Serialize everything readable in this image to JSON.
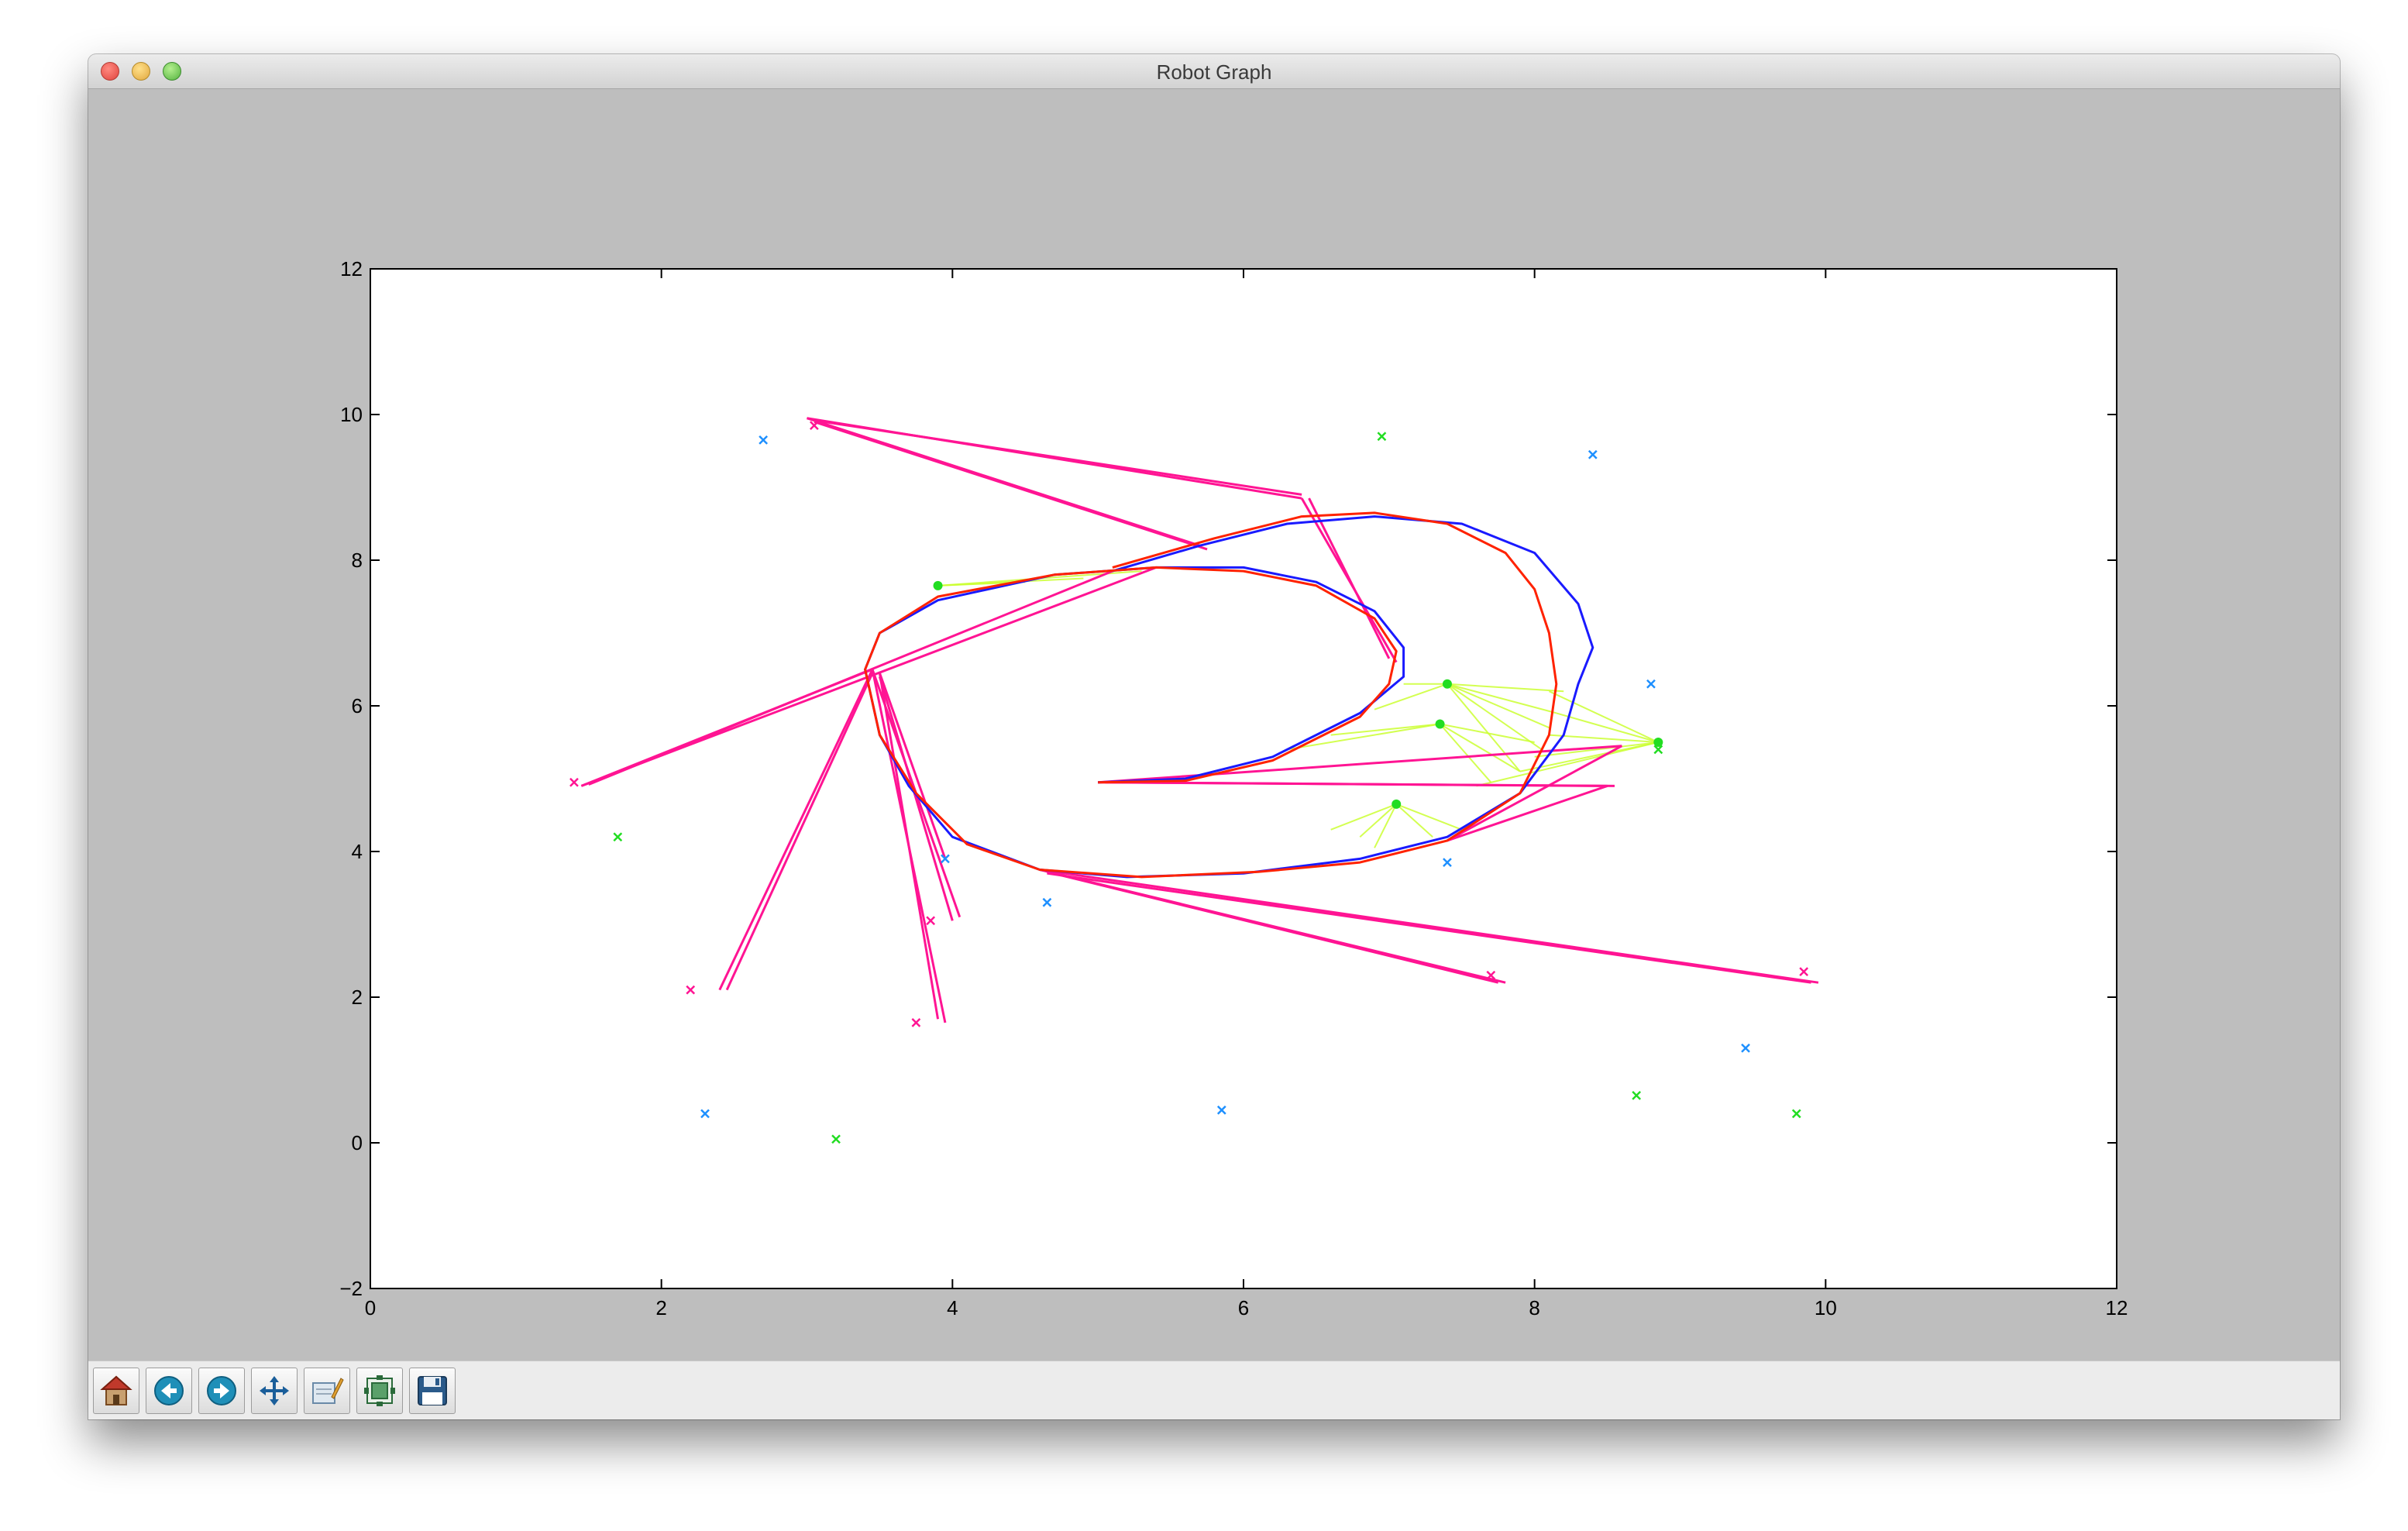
{
  "window": {
    "title": "Robot Graph"
  },
  "toolbar": {
    "buttons": [
      {
        "icon": "home-icon"
      },
      {
        "icon": "back-arrow-icon"
      },
      {
        "icon": "forward-arrow-icon"
      },
      {
        "icon": "pan-icon"
      },
      {
        "icon": "zoom-rectangle-icon"
      },
      {
        "icon": "configure-subplots-icon"
      },
      {
        "icon": "save-icon"
      }
    ]
  },
  "chart_data": {
    "type": "line",
    "title": "",
    "xlabel": "",
    "ylabel": "",
    "xlim": [
      0,
      12
    ],
    "ylim": [
      -2,
      12
    ],
    "xticks": [
      "0",
      "2",
      "4",
      "6",
      "8",
      "10",
      "12"
    ],
    "yticks": [
      "−2",
      "0",
      "2",
      "4",
      "6",
      "8",
      "10",
      "12"
    ],
    "grid": false,
    "colors": {
      "blue": "#1a1aff",
      "red": "#ff2200",
      "magenta": "#ff1493",
      "green": "#22dd22",
      "lime": "#ccff33",
      "cyan": "#1e90ff"
    },
    "series": [
      {
        "color": "blue",
        "points": [
          [
            5.0,
            4.95
          ],
          [
            5.6,
            5.0
          ],
          [
            6.2,
            5.3
          ],
          [
            6.8,
            5.9
          ],
          [
            7.1,
            6.4
          ],
          [
            7.1,
            6.8
          ],
          [
            6.9,
            7.3
          ],
          [
            6.5,
            7.7
          ],
          [
            6.0,
            7.9
          ],
          [
            5.4,
            7.9
          ],
          [
            4.7,
            7.8
          ],
          [
            3.9,
            7.45
          ],
          [
            3.5,
            7.0
          ],
          [
            3.4,
            6.5
          ],
          [
            3.5,
            5.6
          ],
          [
            3.7,
            4.9
          ],
          [
            4.0,
            4.2
          ],
          [
            4.6,
            3.75
          ],
          [
            5.2,
            3.65
          ],
          [
            6.0,
            3.7
          ],
          [
            6.8,
            3.9
          ],
          [
            7.4,
            4.2
          ],
          [
            7.9,
            4.8
          ],
          [
            8.2,
            5.6
          ],
          [
            8.3,
            6.3
          ],
          [
            8.4,
            6.8
          ],
          [
            8.3,
            7.4
          ],
          [
            8.0,
            8.1
          ],
          [
            7.5,
            8.5
          ],
          [
            6.9,
            8.6
          ],
          [
            6.3,
            8.5
          ],
          [
            5.7,
            8.2
          ],
          [
            5.1,
            7.85
          ]
        ]
      },
      {
        "color": "red",
        "points": [
          [
            5.0,
            4.95
          ],
          [
            5.6,
            4.97
          ],
          [
            6.2,
            5.25
          ],
          [
            6.8,
            5.85
          ],
          [
            7.0,
            6.3
          ],
          [
            7.05,
            6.75
          ],
          [
            6.9,
            7.2
          ],
          [
            6.5,
            7.65
          ],
          [
            6.0,
            7.85
          ],
          [
            5.4,
            7.9
          ],
          [
            4.7,
            7.8
          ],
          [
            3.9,
            7.5
          ],
          [
            3.5,
            7.0
          ],
          [
            3.4,
            6.5
          ],
          [
            3.5,
            5.6
          ],
          [
            3.75,
            4.8
          ],
          [
            4.1,
            4.1
          ],
          [
            4.6,
            3.75
          ],
          [
            5.3,
            3.65
          ],
          [
            6.1,
            3.72
          ],
          [
            6.8,
            3.85
          ],
          [
            7.4,
            4.15
          ],
          [
            7.9,
            4.8
          ],
          [
            8.1,
            5.6
          ],
          [
            8.15,
            6.3
          ],
          [
            8.1,
            7.0
          ],
          [
            8.0,
            7.6
          ],
          [
            7.8,
            8.1
          ],
          [
            7.4,
            8.5
          ],
          [
            6.9,
            8.65
          ],
          [
            6.4,
            8.6
          ],
          [
            5.8,
            8.3
          ],
          [
            5.1,
            7.9
          ]
        ]
      }
    ],
    "magenta_edges": [
      [
        [
          3.0,
          9.95
        ],
        [
          6.4,
          8.85
        ]
      ],
      [
        [
          3.05,
          9.92
        ],
        [
          6.4,
          8.9
        ]
      ],
      [
        [
          3.0,
          9.95
        ],
        [
          5.7,
          8.2
        ]
      ],
      [
        [
          3.05,
          9.9
        ],
        [
          5.75,
          8.15
        ]
      ],
      [
        [
          6.4,
          8.85
        ],
        [
          7.05,
          6.6
        ]
      ],
      [
        [
          6.45,
          8.85
        ],
        [
          7.0,
          6.65
        ]
      ],
      [
        [
          1.45,
          4.9
        ],
        [
          5.4,
          7.9
        ]
      ],
      [
        [
          1.5,
          4.92
        ],
        [
          5.1,
          7.85
        ]
      ],
      [
        [
          1.45,
          4.9
        ],
        [
          3.45,
          6.5
        ]
      ],
      [
        [
          3.45,
          6.5
        ],
        [
          2.4,
          2.1
        ]
      ],
      [
        [
          3.45,
          6.45
        ],
        [
          2.45,
          2.1
        ]
      ],
      [
        [
          3.45,
          6.5
        ],
        [
          3.95,
          1.65
        ]
      ],
      [
        [
          3.5,
          6.45
        ],
        [
          3.9,
          1.7
        ]
      ],
      [
        [
          3.45,
          6.5
        ],
        [
          4.05,
          3.1
        ]
      ],
      [
        [
          3.5,
          6.4
        ],
        [
          4.0,
          3.05
        ]
      ],
      [
        [
          3.5,
          6.45
        ],
        [
          3.95,
          3.9
        ]
      ],
      [
        [
          4.6,
          3.75
        ],
        [
          7.8,
          2.2
        ]
      ],
      [
        [
          4.65,
          3.72
        ],
        [
          7.75,
          2.2
        ]
      ],
      [
        [
          4.6,
          3.75
        ],
        [
          9.95,
          2.2
        ]
      ],
      [
        [
          4.65,
          3.7
        ],
        [
          9.9,
          2.2
        ]
      ],
      [
        [
          5.0,
          4.95
        ],
        [
          8.6,
          5.45
        ]
      ],
      [
        [
          5.0,
          4.95
        ],
        [
          8.5,
          4.9
        ]
      ],
      [
        [
          5.05,
          4.95
        ],
        [
          8.55,
          4.9
        ]
      ],
      [
        [
          7.4,
          4.15
        ],
        [
          8.6,
          5.45
        ]
      ],
      [
        [
          7.4,
          4.15
        ],
        [
          8.5,
          4.9
        ]
      ]
    ],
    "green_hubs": [
      [
        3.9,
        7.65
      ],
      [
        7.4,
        6.3
      ],
      [
        7.35,
        5.75
      ],
      [
        7.05,
        4.65
      ],
      [
        8.85,
        5.5
      ]
    ],
    "lime_edges": [
      [
        [
          3.9,
          7.65
        ],
        [
          5.3,
          7.85
        ]
      ],
      [
        [
          3.9,
          7.65
        ],
        [
          4.9,
          7.75
        ]
      ],
      [
        [
          3.9,
          7.65
        ],
        [
          4.5,
          7.7
        ]
      ],
      [
        [
          7.4,
          6.3
        ],
        [
          8.2,
          6.2
        ]
      ],
      [
        [
          7.4,
          6.3
        ],
        [
          8.15,
          5.9
        ]
      ],
      [
        [
          7.4,
          6.3
        ],
        [
          8.1,
          5.7
        ]
      ],
      [
        [
          7.4,
          6.3
        ],
        [
          8.05,
          5.4
        ]
      ],
      [
        [
          7.4,
          6.3
        ],
        [
          7.9,
          5.1
        ]
      ],
      [
        [
          7.4,
          6.3
        ],
        [
          7.1,
          6.3
        ]
      ],
      [
        [
          7.4,
          6.3
        ],
        [
          6.9,
          5.95
        ]
      ],
      [
        [
          7.35,
          5.75
        ],
        [
          6.6,
          5.6
        ]
      ],
      [
        [
          7.35,
          5.75
        ],
        [
          6.3,
          5.4
        ]
      ],
      [
        [
          7.35,
          5.75
        ],
        [
          7.9,
          5.1
        ]
      ],
      [
        [
          7.35,
          5.75
        ],
        [
          7.7,
          4.95
        ]
      ],
      [
        [
          7.35,
          5.75
        ],
        [
          8.0,
          5.5
        ]
      ],
      [
        [
          7.05,
          4.65
        ],
        [
          6.8,
          4.2
        ]
      ],
      [
        [
          7.05,
          4.65
        ],
        [
          6.9,
          4.05
        ]
      ],
      [
        [
          7.05,
          4.65
        ],
        [
          7.3,
          4.2
        ]
      ],
      [
        [
          7.05,
          4.65
        ],
        [
          7.5,
          4.3
        ]
      ],
      [
        [
          7.05,
          4.65
        ],
        [
          6.6,
          4.3
        ]
      ],
      [
        [
          8.85,
          5.5
        ],
        [
          8.1,
          6.2
        ]
      ],
      [
        [
          8.85,
          5.5
        ],
        [
          8.15,
          5.9
        ]
      ],
      [
        [
          8.85,
          5.5
        ],
        [
          8.1,
          5.6
        ]
      ],
      [
        [
          8.85,
          5.5
        ],
        [
          8.0,
          5.3
        ]
      ],
      [
        [
          8.85,
          5.5
        ],
        [
          7.9,
          5.1
        ]
      ],
      [
        [
          8.85,
          5.5
        ],
        [
          7.6,
          4.9
        ]
      ]
    ],
    "cyan_points": [
      [
        2.7,
        9.65
      ],
      [
        8.4,
        9.45
      ],
      [
        8.8,
        6.3
      ],
      [
        7.4,
        3.85
      ],
      [
        4.65,
        3.3
      ],
      [
        3.95,
        3.9
      ],
      [
        9.45,
        1.3
      ],
      [
        2.3,
        0.4
      ],
      [
        5.85,
        0.45
      ]
    ],
    "green_points": [
      [
        6.95,
        9.7
      ],
      [
        1.7,
        4.2
      ],
      [
        3.2,
        0.05
      ],
      [
        8.7,
        0.65
      ],
      [
        9.8,
        0.4
      ],
      [
        8.85,
        5.4
      ]
    ],
    "magenta_points": [
      [
        1.4,
        4.95
      ],
      [
        3.05,
        9.85
      ],
      [
        2.2,
        2.1
      ],
      [
        3.75,
        1.65
      ],
      [
        3.85,
        3.05
      ],
      [
        7.7,
        2.3
      ],
      [
        9.85,
        2.35
      ]
    ]
  }
}
